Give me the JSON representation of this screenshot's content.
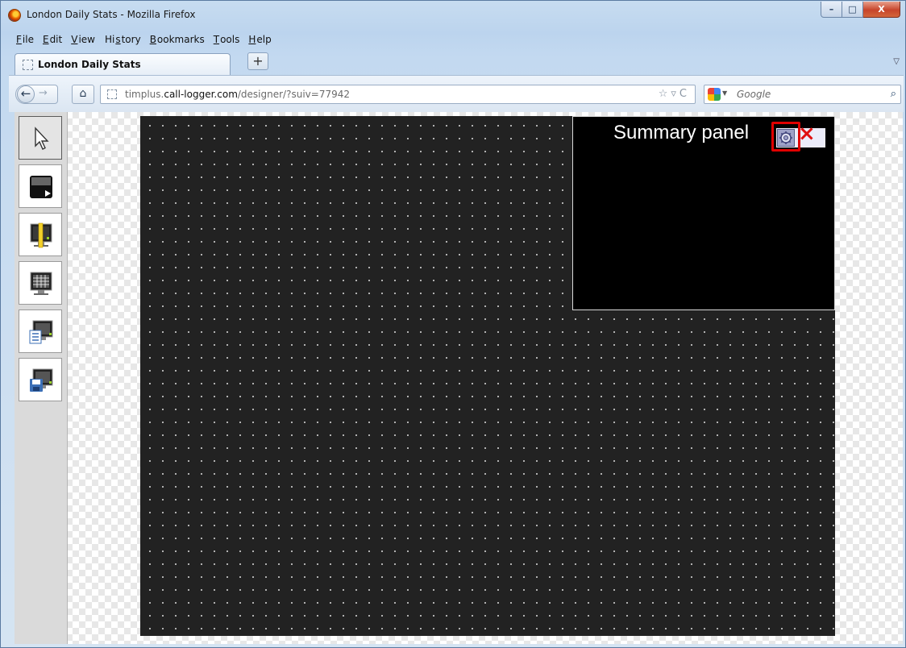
{
  "window": {
    "title": "London Daily Stats - Mozilla Firefox",
    "controls": {
      "minimize": "–",
      "maximize": "□",
      "close": "X"
    }
  },
  "menu": [
    {
      "label": "File",
      "accel": "F",
      "rest": "ile"
    },
    {
      "label": "Edit",
      "accel": "E",
      "rest": "dit"
    },
    {
      "label": "View",
      "accel": "V",
      "rest": "iew"
    },
    {
      "label": "History",
      "pre": "Hi",
      "accel": "s",
      "rest": "tory"
    },
    {
      "label": "Bookmarks",
      "accel": "B",
      "rest": "ookmarks"
    },
    {
      "label": "Tools",
      "accel": "T",
      "rest": "ools"
    },
    {
      "label": "Help",
      "accel": "H",
      "rest": "elp"
    }
  ],
  "tabs": [
    {
      "label": "London Daily Stats",
      "active": true
    }
  ],
  "tabstrip": {
    "new_tab": "+",
    "list_tabs": "▽"
  },
  "nav": {
    "back": "←",
    "forward": "→",
    "home": "⌂",
    "url": {
      "prefix": "timplus.",
      "domain": "call-logger.com",
      "path": "/designer/?suiv=77942"
    },
    "url_tools": "☆▿C",
    "search_placeholder": "Google",
    "search_go": "⌕"
  },
  "toolbox": {
    "tools": [
      {
        "name": "pointer-tool",
        "icon": "cursor-arrow-icon",
        "selected": true
      },
      {
        "name": "video-panel-tool",
        "icon": "monitor-play-icon",
        "selected": false
      },
      {
        "name": "gauge-panel-tool",
        "icon": "monitor-ruler-icon",
        "selected": false
      },
      {
        "name": "grid-panel-tool",
        "icon": "monitor-grid-icon",
        "selected": false
      },
      {
        "name": "list-panel-tool",
        "icon": "monitor-list-icon",
        "selected": false
      },
      {
        "name": "save-tool",
        "icon": "monitor-save-icon",
        "selected": false
      }
    ]
  },
  "canvas": {
    "background": "#222222",
    "panel": {
      "title": "Summary panel",
      "close_symbol": "×",
      "highlight_color": "#e00000"
    }
  }
}
